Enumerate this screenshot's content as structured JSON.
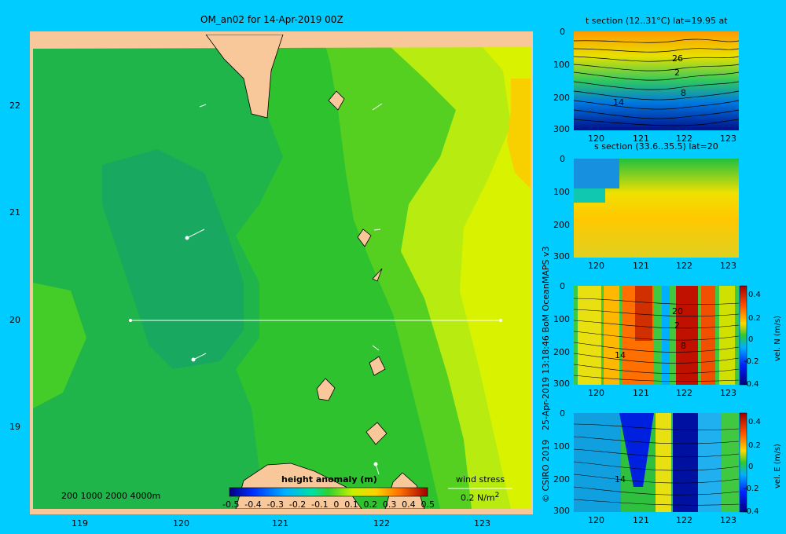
{
  "main_map": {
    "title": "OM_an02 for 14-Apr-2019 00Z",
    "x_ticks": [
      "119",
      "120",
      "121",
      "122",
      "123"
    ],
    "y_ticks": [
      "22",
      "21",
      "20",
      "19"
    ],
    "depth_legend": "200  1000  2000  4000m",
    "colorbar_title": "height anomaly (m)",
    "colorbar_ticks": [
      "-0.5",
      "-0.4",
      "-0.3",
      "-0.2",
      "-0.1",
      "0",
      "0.1",
      "0.2",
      "0.3",
      "0.4",
      "0.5"
    ],
    "wind_stress_label": "wind stress",
    "wind_stress_scale": "0.2 N/m",
    "wind_stress_exp": "2"
  },
  "panels": [
    {
      "title": "t section (12..31°C) lat=19.95 at",
      "contour_labels": [
        "26",
        "2",
        "8",
        "14"
      ]
    },
    {
      "title": "s section (33.6..35.5) lat=20",
      "contour_labels": []
    },
    {
      "title": "",
      "contour_labels": [
        "20",
        "2",
        "8",
        "14"
      ],
      "cb_label": "vel. N (m/s)"
    },
    {
      "title": "",
      "contour_labels": [
        "14"
      ],
      "cb_label": "vel. E (m/s)"
    }
  ],
  "section_y_ticks": [
    "0",
    "100",
    "200",
    "300"
  ],
  "section_x_ticks": [
    "120",
    "121",
    "122",
    "123"
  ],
  "vel_cb_ticks": [
    "0.4",
    "0.2",
    "0",
    "-0.2",
    "-0.4"
  ],
  "side_credit_1": "© CSIRO 2019",
  "side_credit_2": "25-Apr-2019 13:18:46 BoM OceanMAPS v3",
  "chart_data": {
    "type": "heatmap",
    "title": "OM_an02 for 14-Apr-2019 00Z",
    "xlabel": "",
    "ylabel": "",
    "xlim": [
      118.5,
      123.5
    ],
    "ylim": [
      18.3,
      22.7
    ],
    "colorbar": {
      "label": "height anomaly (m)",
      "range": [
        -0.5,
        0.5
      ]
    },
    "section_line": {
      "lat": 20,
      "lon_range": [
        119.5,
        123.2
      ]
    },
    "sections": [
      {
        "name": "t section",
        "range": "12..31°C",
        "lat": 19.95,
        "depth_range": [
          0,
          300
        ],
        "lon_range": [
          119.5,
          123.2
        ]
      },
      {
        "name": "s section",
        "range": "33.6..35.5",
        "lat": 20,
        "depth_range": [
          0,
          300
        ],
        "lon_range": [
          119.5,
          123.2
        ]
      },
      {
        "name": "vel. N",
        "units": "m/s",
        "range": [
          -0.4,
          0.4
        ],
        "depth_range": [
          0,
          300
        ],
        "lon_range": [
          119.5,
          123.2
        ]
      },
      {
        "name": "vel. E",
        "units": "m/s",
        "range": [
          -0.4,
          0.4
        ],
        "depth_range": [
          0,
          300
        ],
        "lon_range": [
          119.5,
          123.2
        ]
      }
    ]
  }
}
